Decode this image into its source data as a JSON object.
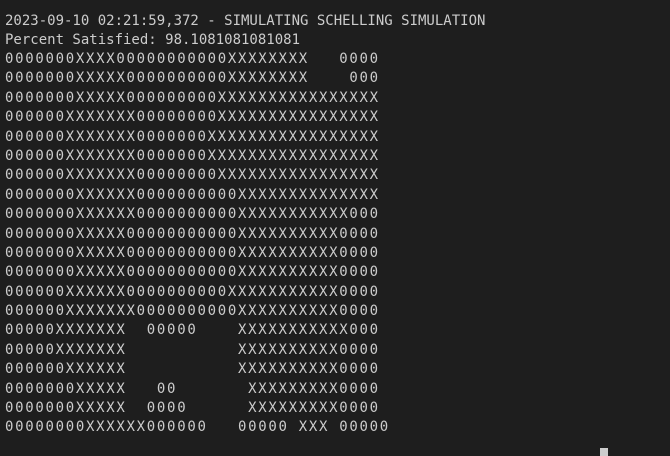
{
  "terminal": {
    "log_line": "2023-09-10 02:21:59,372 - SIMULATING SCHELLING SIMULATION",
    "status_line": "Percent Satisfied: 98.1081081081081",
    "grid": [
      "0000000XXXX00000000000XXXXXXXX   0000",
      "0000000XXXXX0000000000XXXXXXXX    000",
      "0000000XXXXX000000000XXXXXXXXXXXXXXXX",
      "000000XXXXXXX00000000XXXXXXXXXXXXXXXX",
      "000000XXXXXXX0000000XXXXXXXXXXXXXXXXX",
      "000000XXXXXXX0000000XXXXXXXXXXXXXXXXX",
      "000000XXXXXXX00000000XXXXXXXXXXXXXXXX",
      "0000000XXXXXX0000000000XXXXXXXXXXXXXX",
      "0000000XXXXXX0000000000XXXXXXXXXXX000",
      "0000000XXXXX00000000000XXXXXXXXXX0000",
      "0000000XXXXX00000000000XXXXXXXXXX0000",
      "0000000XXXXX00000000000XXXXXXXXXX0000",
      "000000XXXXXX0000000000XXXXXXXXXXX0000",
      "000000XXXXXXX0000000000XXXXXXXXXX0000",
      "00000XXXXXXX  00000    XXXXXXXXXXX000",
      "00000XXXXXXX           XXXXXXXXXX0000",
      "000000XXXXXX           XXXXXXXXXX0000",
      "0000000XXXXX   00       XXXXXXXXX0000",
      "0000000XXXXX  0000      XXXXXXXXX0000",
      "00000000XXXXXX000000   00000 XXX 00000"
    ]
  }
}
